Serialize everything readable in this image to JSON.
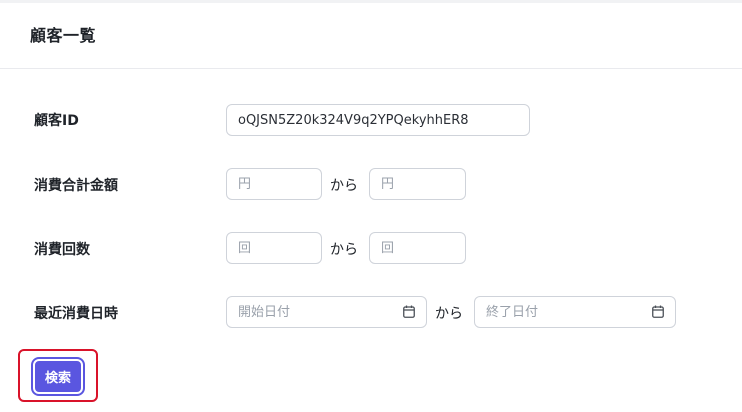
{
  "page": {
    "title": "顧客一覧"
  },
  "filters": {
    "customer_id": {
      "label": "顧客ID",
      "value": "oQJSN5Z20k324V9q2YPQekyhhER8"
    },
    "total_spend": {
      "label": "消費合計金額",
      "from_placeholder": "円",
      "to_placeholder": "円",
      "separator": "から"
    },
    "visit_count": {
      "label": "消費回数",
      "from_placeholder": "回",
      "to_placeholder": "回",
      "separator": "から"
    },
    "last_visit": {
      "label": "最近消費日時",
      "from_placeholder": "開始日付",
      "to_placeholder": "終了日付",
      "separator": "から",
      "icon": "calendar-icon"
    }
  },
  "actions": {
    "search_label": "検索",
    "accent": "#5a56e0",
    "highlight": "#d9132a"
  }
}
